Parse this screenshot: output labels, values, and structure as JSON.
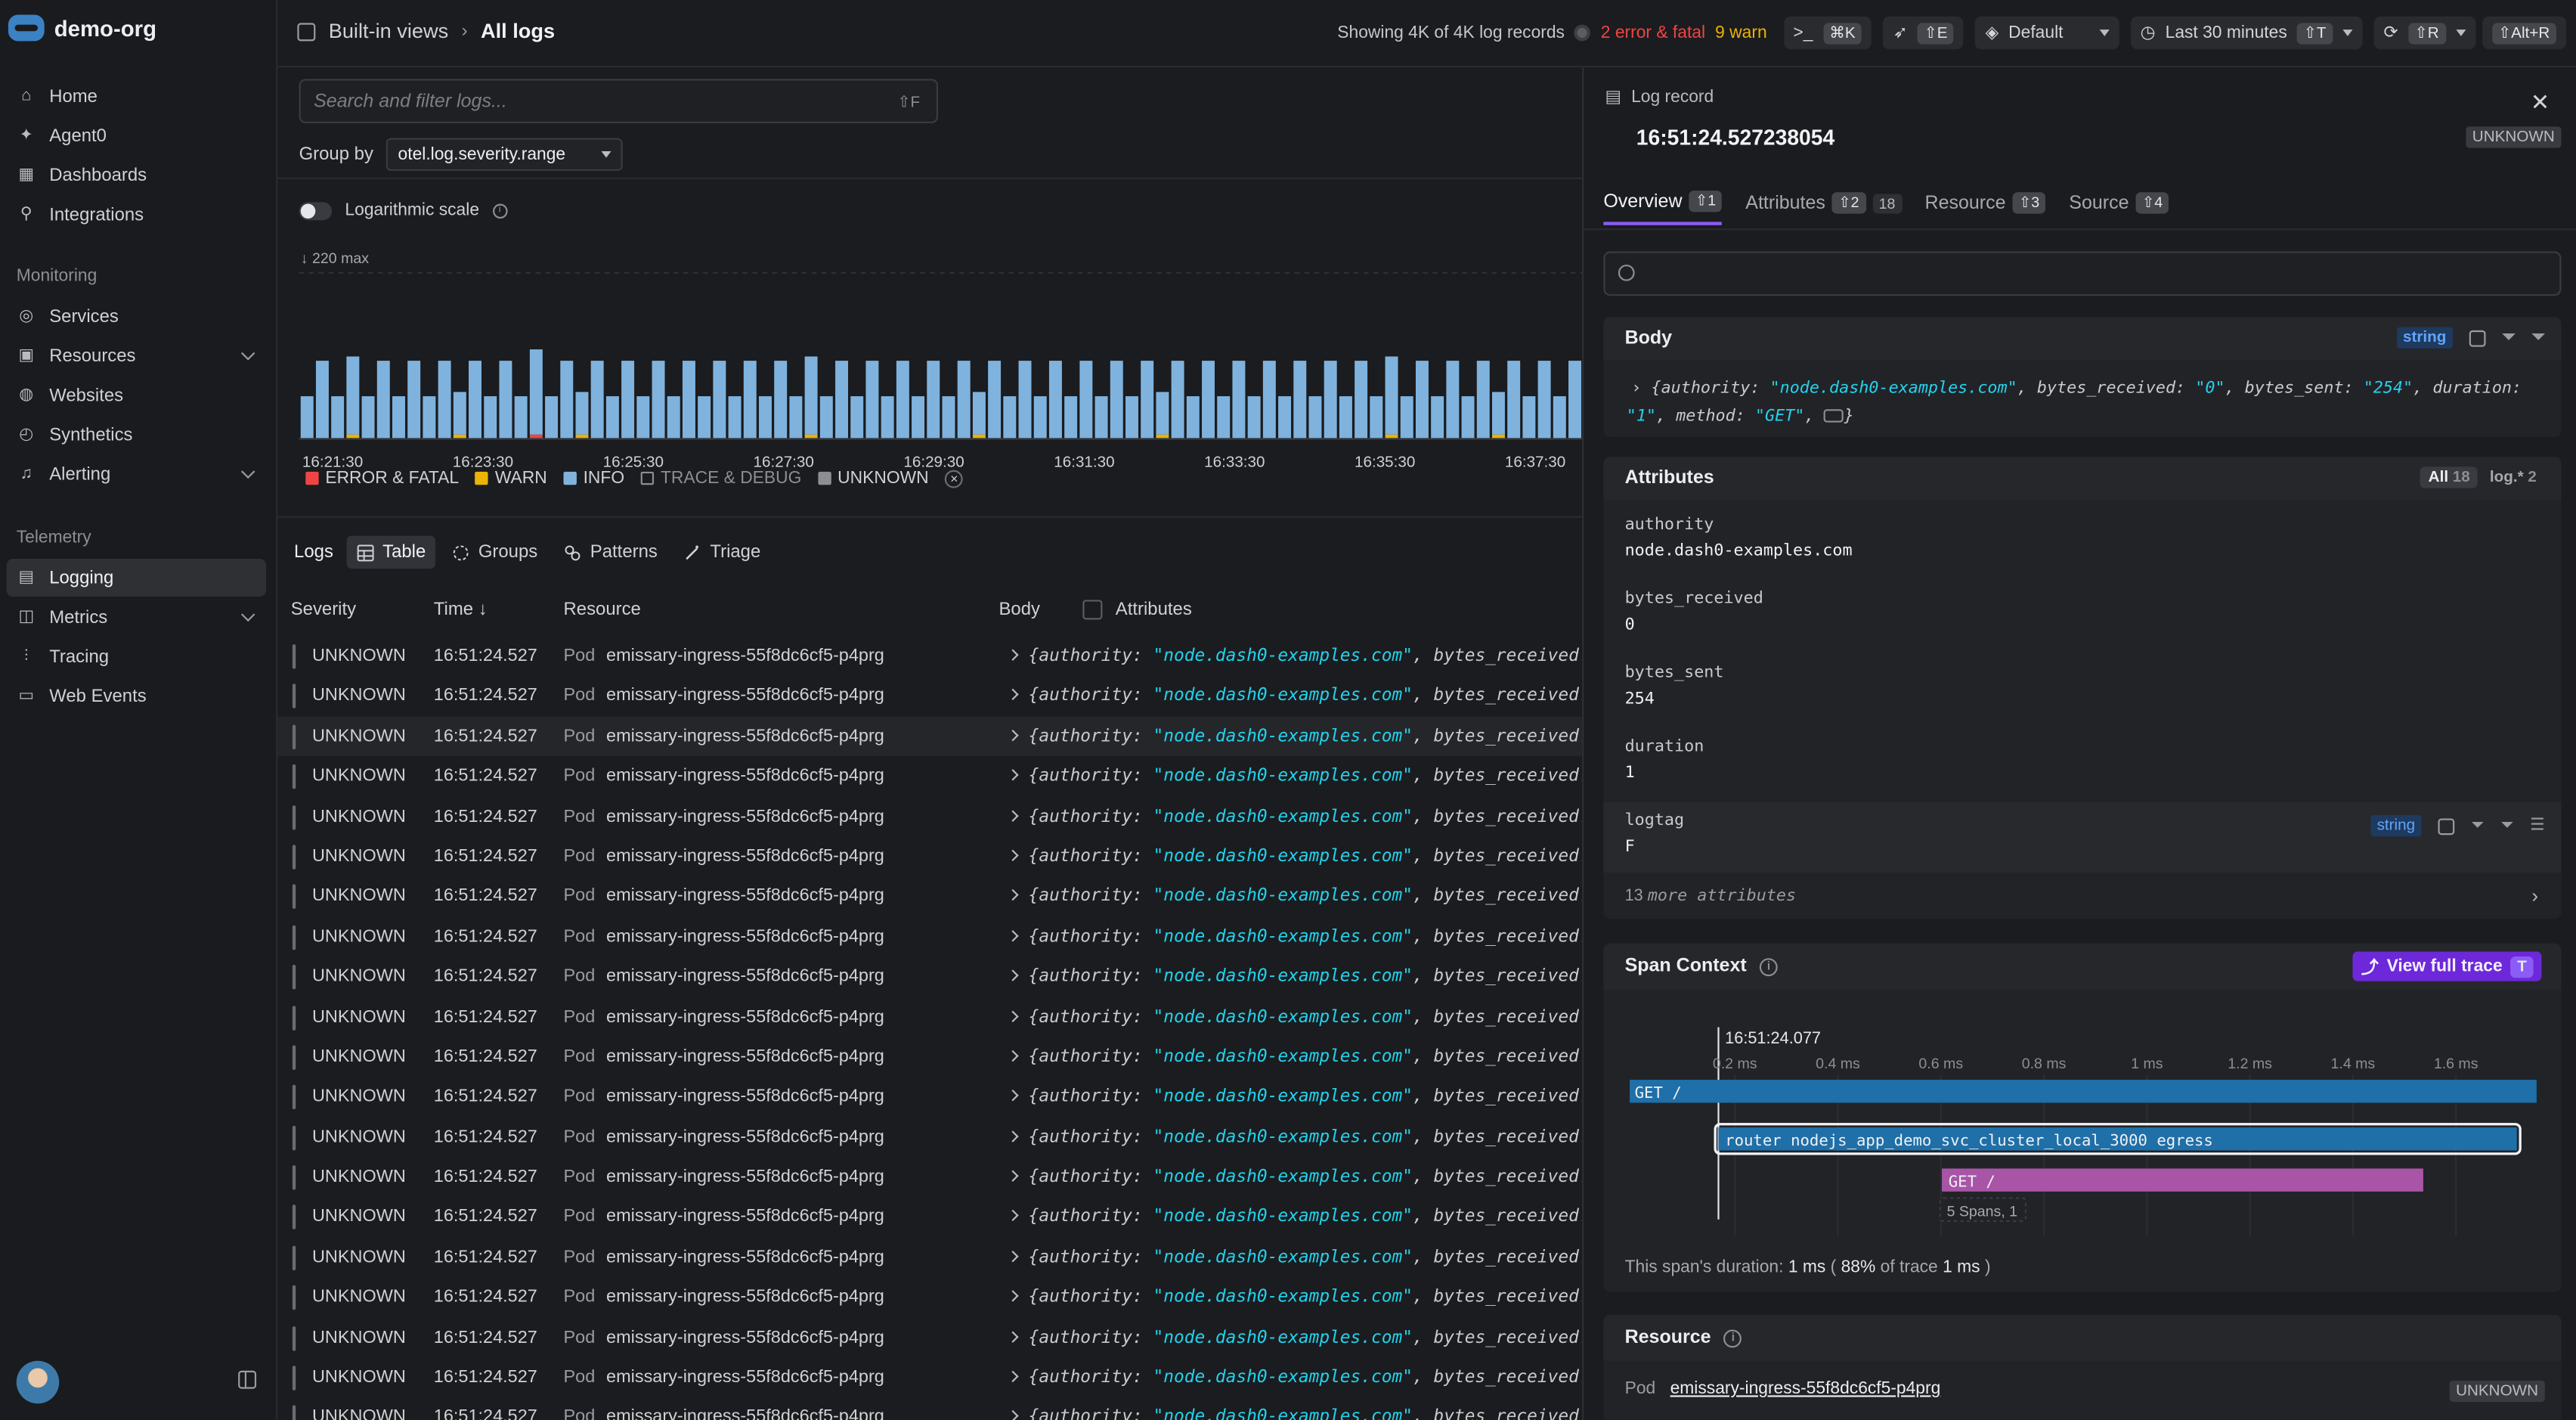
{
  "org": {
    "name": "demo-org"
  },
  "nav": {
    "items_top": [
      {
        "label": "Home",
        "icon": "home-icon"
      },
      {
        "label": "Agent0",
        "icon": "sparkle-icon"
      },
      {
        "label": "Dashboards",
        "icon": "dashboard-icon"
      },
      {
        "label": "Integrations",
        "icon": "plug-icon"
      }
    ],
    "monitoring_label": "Monitoring",
    "items_monitoring": [
      {
        "label": "Services",
        "icon": "services-icon"
      },
      {
        "label": "Resources",
        "icon": "resources-icon",
        "expandable": true
      },
      {
        "label": "Websites",
        "icon": "globe-icon"
      },
      {
        "label": "Synthetics",
        "icon": "synthetics-icon"
      },
      {
        "label": "Alerting",
        "icon": "bell-icon",
        "expandable": true
      }
    ],
    "telemetry_label": "Telemetry",
    "items_telemetry": [
      {
        "label": "Logging",
        "icon": "logging-icon",
        "active": true
      },
      {
        "label": "Metrics",
        "icon": "metrics-icon",
        "expandable": true
      },
      {
        "label": "Tracing",
        "icon": "tracing-icon"
      },
      {
        "label": "Web Events",
        "icon": "web-events-icon"
      }
    ]
  },
  "topbar": {
    "breadcrumb_1": "Built-in views",
    "breadcrumb_2": "All logs",
    "showing": "Showing 4K of 4K log records",
    "errors": "2 error & fatal",
    "warns": "9 warn",
    "cmd_kbd": "⌘K",
    "share_kbd": "⇧E",
    "dataset": "Default",
    "timerange": "Last 30 minutes",
    "time_kbd": "⇧T",
    "refresh_kbd": "⇧R",
    "auto_kbd": "⇧Alt+R"
  },
  "filters": {
    "search_placeholder": "Search and filter logs...",
    "search_kbd": "⇧F",
    "groupby_label": "Group by",
    "groupby_value": "otel.log.severity.range",
    "logscale_label": "Logarithmic scale",
    "max_label": "220 max"
  },
  "chart_data": {
    "type": "bar",
    "ymax": 220,
    "x_ticks": [
      "16:21:30",
      "16:23:30",
      "16:25:30",
      "16:27:30",
      "16:29:30",
      "16:31:30",
      "16:33:30",
      "16:35:30",
      "16:37:30"
    ],
    "series": [
      {
        "name": "INFO",
        "color": "#7fb3de",
        "values": [
          60,
          110,
          60,
          110,
          60,
          110,
          60,
          110,
          60,
          110,
          60,
          110,
          60,
          110,
          60,
          120,
          60,
          110,
          60,
          110,
          60,
          110,
          60,
          110,
          60,
          110,
          60,
          110,
          60,
          110,
          60,
          110,
          60,
          110,
          60,
          110,
          60,
          110,
          60,
          110,
          60,
          110,
          60,
          110,
          60,
          110,
          60,
          110,
          60,
          110,
          60,
          110,
          60,
          110,
          60,
          110,
          60,
          110,
          60,
          110,
          60,
          110,
          60,
          110,
          60,
          110,
          60,
          110,
          60,
          110,
          60,
          110,
          60,
          110,
          60,
          110,
          60,
          110,
          60,
          110,
          60,
          110,
          60,
          110,
          60,
          110,
          60,
          110
        ]
      },
      {
        "name": "WARN",
        "color": "#eab308",
        "values": [
          0,
          0,
          0,
          6,
          0,
          0,
          0,
          0,
          0,
          0,
          6,
          0,
          0,
          0,
          0,
          0,
          0,
          0,
          6,
          0,
          0,
          0,
          0,
          0,
          0,
          0,
          0,
          0,
          0,
          0,
          0,
          0,
          0,
          6,
          0,
          0,
          0,
          0,
          0,
          0,
          0,
          0,
          0,
          0,
          6,
          0,
          0,
          0,
          0,
          0,
          0,
          0,
          0,
          0,
          0,
          0,
          6,
          0,
          0,
          0,
          0,
          0,
          0,
          0,
          0,
          0,
          0,
          0,
          0,
          0,
          0,
          6,
          0,
          0,
          0,
          0,
          0,
          0,
          6,
          0,
          0,
          0,
          0,
          0,
          0,
          0,
          6,
          0
        ]
      },
      {
        "name": "ERROR & FATAL",
        "color": "#ef4444",
        "values": [
          0,
          0,
          0,
          0,
          0,
          0,
          0,
          0,
          0,
          0,
          0,
          0,
          0,
          0,
          0,
          6,
          0,
          0,
          0,
          0,
          0,
          0,
          0,
          0,
          0,
          0,
          0,
          0,
          0,
          0,
          0,
          0,
          0,
          0,
          0,
          0,
          0,
          0,
          0,
          0,
          0,
          0,
          0,
          0,
          0,
          0,
          0,
          0,
          0,
          0,
          0,
          0,
          0,
          0,
          0,
          0,
          0,
          0,
          0,
          0,
          0,
          0,
          0,
          0,
          0,
          0,
          0,
          0,
          0,
          0,
          0,
          0,
          0,
          0,
          0,
          0,
          0,
          0,
          0,
          0,
          0,
          0,
          0,
          0,
          0,
          0,
          0,
          0
        ]
      }
    ]
  },
  "legend": [
    {
      "label": "ERROR & FATAL",
      "color": "#ef4444"
    },
    {
      "label": "WARN",
      "color": "#eab308"
    },
    {
      "label": "INFO",
      "color": "#7fb3de"
    },
    {
      "label": "TRACE & DEBUG",
      "color": "outline"
    },
    {
      "label": "UNKNOWN",
      "color": "#8c8e94"
    }
  ],
  "view_tabs": {
    "label": "Logs",
    "items": [
      "Table",
      "Groups",
      "Patterns",
      "Triage"
    ]
  },
  "table": {
    "columns": [
      "Severity",
      "Time ↓",
      "Resource",
      "Body",
      "Attributes"
    ],
    "row_template": {
      "severity": "UNKNOWN",
      "time": "16:51:24.527",
      "resource_type": "Pod",
      "resource": "emissary-ingress-55f8dc6cf5-p4prg",
      "body_k1": "{authority: ",
      "body_v1": "\"node.dash0-examples.com\"",
      "body_k2": ", bytes_received: ",
      "body_v2": "\""
    },
    "row_count": 20,
    "selected_row": 2
  },
  "panel": {
    "header": "Log record",
    "timestamp": "16:51:24.527238054",
    "severity_badge": "UNKNOWN",
    "tabs": [
      {
        "label": "Overview",
        "kbd": "⇧1",
        "count": ""
      },
      {
        "label": "Attributes",
        "kbd": "⇧2",
        "count": "18"
      },
      {
        "label": "Resource",
        "kbd": "⇧3",
        "count": ""
      },
      {
        "label": "Source",
        "kbd": "⇧4",
        "count": ""
      }
    ],
    "body": {
      "title": "Body",
      "type": "string",
      "line1_a": "{authority: ",
      "line1_b": "\"node.dash0-examples.com\"",
      "line1_c": ", bytes_received: ",
      "line1_d": "\"0\"",
      "line1_e": ", bytes_sent: ",
      "line1_f": "\"254\"",
      "line1_g": ", duration:",
      "line2_a": "\"1\"",
      "line2_b": ", method: ",
      "line2_c": "\"GET\"",
      "line2_d": ", ",
      "line2_e": "}"
    },
    "attributes": {
      "title": "Attributes",
      "filter_all": "All",
      "filter_all_count": "18",
      "filter_log": "log.*",
      "filter_log_count": "2",
      "items": [
        {
          "key": "authority",
          "value": "node.dash0-examples.com"
        },
        {
          "key": "bytes_received",
          "value": "0"
        },
        {
          "key": "bytes_sent",
          "value": "254"
        },
        {
          "key": "duration",
          "value": "1"
        },
        {
          "key": "logtag",
          "value": "F",
          "type": "string"
        }
      ],
      "more_count": "13",
      "more_label": "more attributes"
    },
    "span_context": {
      "title": "Span Context",
      "button": "View full trace",
      "button_kbd": "T",
      "cursor_time": "16:51:24.077",
      "ticks": [
        "0.2 ms",
        "0.4 ms",
        "0.6 ms",
        "0.8 ms",
        "1 ms",
        "1.2 ms",
        "1.4 ms",
        "1.6 ms"
      ],
      "spans": [
        {
          "name": "GET /",
          "color": "#1f6fa8"
        },
        {
          "name": "router nodejs_app_demo_svc_cluster_local_3000 egress",
          "color": "#1f6fa8"
        },
        {
          "name": "GET /",
          "color": "#a855a8"
        }
      ],
      "collapsed": "5 Spans, 1",
      "dur_prefix": "This span's duration:",
      "dur_value": "1 ms",
      "pct_value": "88%",
      "pct_suffix": "of trace",
      "trace_value": "1 ms"
    },
    "resource": {
      "title": "Resource",
      "type_label": "Pod",
      "name": "emissary-ingress-55f8dc6cf5-p4prg",
      "badge": "UNKNOWN"
    }
  }
}
